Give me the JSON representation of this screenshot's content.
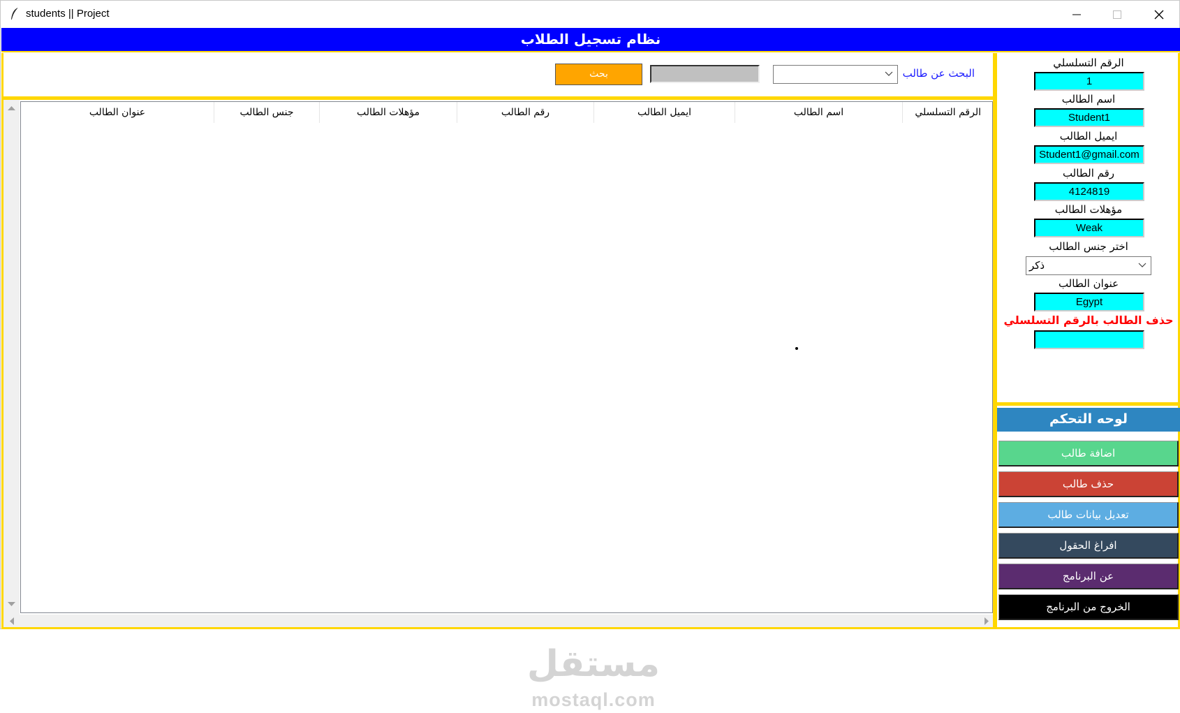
{
  "window": {
    "title": "students || Project",
    "icon": "feather-icon"
  },
  "header": {
    "title": "نظام تسجيل الطلاب",
    "bg_color": "#0000ff",
    "border_color": "#ffd700"
  },
  "search": {
    "label": "البحث عن طالب",
    "combo_value": "",
    "entry_value": "",
    "button_label": "بحث",
    "button_color": "#ffa500"
  },
  "table": {
    "columns": [
      "الرقم التسلسلي",
      "اسم الطالب",
      "ايميل الطالب",
      "رقم الطالب",
      "مؤهلات الطالب",
      "جنس الطالب",
      "عنوان الطالب"
    ],
    "rows": []
  },
  "form": {
    "id_label": "الرقم التسلسلي",
    "id_value": "1",
    "name_label": "اسم الطالب",
    "name_value": "Student1",
    "email_label": "ايميل الطالب",
    "email_value": "Student1@gmail.com",
    "phone_label": "رقم الطالب",
    "phone_value": "4124819",
    "qual_label": "مؤهلات الطالب",
    "qual_value": "Weak",
    "gender_label": "اختر جنس الطالب",
    "gender_value": "ذكر",
    "address_label": "عنوان الطالب",
    "address_value": "Egypt",
    "delete_label": "حذف الطالب بالرقم التسلسلي",
    "delete_value": "",
    "entry_color": "#00ffff"
  },
  "panel": {
    "title": "لوحه التحكم",
    "buttons": [
      {
        "label": "اضافة طالب",
        "color": "#58d68d"
      },
      {
        "label": "حذف طالب",
        "color": "#cb4335"
      },
      {
        "label": "تعديل بيانات طالب",
        "color": "#5dade2"
      },
      {
        "label": "افراغ الحقول",
        "color": "#34495e"
      },
      {
        "label": "عن البرنامج",
        "color": "#5b2c6f"
      },
      {
        "label": "الخروج من البرنامج",
        "color": "#000000"
      }
    ]
  },
  "watermark": {
    "arabic": "مستقل",
    "latin": "mostaql.com"
  }
}
